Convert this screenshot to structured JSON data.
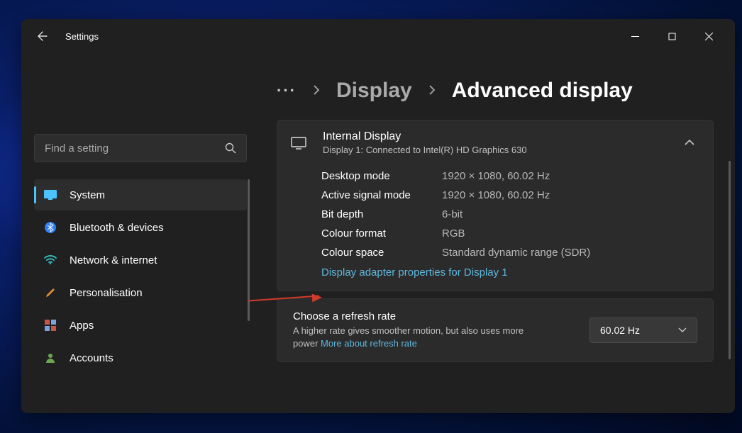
{
  "titlebar": {
    "title": "Settings"
  },
  "sidebar": {
    "search_placeholder": "Find a setting",
    "items": [
      {
        "label": "System",
        "active": true,
        "icon": "monitor",
        "color": "#4cc2ff"
      },
      {
        "label": "Bluetooth & devices",
        "active": false,
        "icon": "bluetooth",
        "color": "#2e7cf6"
      },
      {
        "label": "Network & internet",
        "active": false,
        "icon": "wifi",
        "color": "#36c2c2"
      },
      {
        "label": "Personalisation",
        "active": false,
        "icon": "brush",
        "color": "#d68a3a"
      },
      {
        "label": "Apps",
        "active": false,
        "icon": "apps",
        "color": "#c4564c"
      },
      {
        "label": "Accounts",
        "active": false,
        "icon": "person",
        "color": "#6aa84f"
      }
    ]
  },
  "breadcrumb": {
    "more": "···",
    "link": "Display",
    "current": "Advanced display"
  },
  "display_card": {
    "title": "Internal Display",
    "subtitle": "Display 1: Connected to Intel(R) HD Graphics 630",
    "rows": [
      {
        "label": "Desktop mode",
        "value": "1920 × 1080, 60.02 Hz"
      },
      {
        "label": "Active signal mode",
        "value": "1920 × 1080, 60.02 Hz"
      },
      {
        "label": "Bit depth",
        "value": "6-bit"
      },
      {
        "label": "Colour format",
        "value": "RGB"
      },
      {
        "label": "Colour space",
        "value": "Standard dynamic range (SDR)"
      }
    ],
    "adapter_link": "Display adapter properties for Display 1"
  },
  "refresh_card": {
    "title": "Choose a refresh rate",
    "desc": "A higher rate gives smoother motion, but also uses more power  ",
    "more_link": "More about refresh rate",
    "selected": "60.02 Hz"
  }
}
